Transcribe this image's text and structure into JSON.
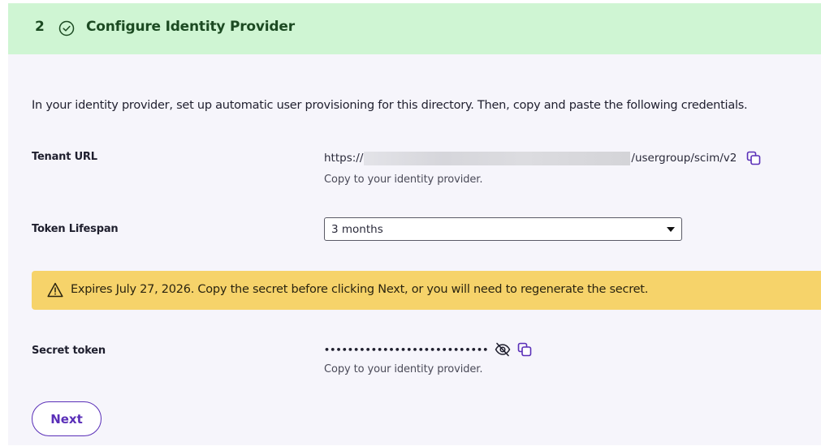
{
  "header": {
    "step_number": "2",
    "title": "Configure Identity Provider",
    "bg_color": "#cff5d3",
    "text_color": "#1c4a22"
  },
  "intro_text": "In your identity provider, set up automatic user provisioning for this directory. Then, copy and paste the following credentials.",
  "tenant_url": {
    "label": "Tenant URL",
    "prefix": "https://",
    "suffix": "/usergroup/scim/v2",
    "hint": "Copy to your identity provider."
  },
  "token_lifespan": {
    "label": "Token Lifespan",
    "selected": "3 months"
  },
  "warning": {
    "text": "Expires July 27, 2026. Copy the secret before clicking Next, or you will need to regenerate the secret.",
    "bg_color": "#f6d36a"
  },
  "secret_token": {
    "label": "Secret token",
    "masked_value": "••••••••••••••••••••••••••••",
    "hint": "Copy to your identity provider."
  },
  "actions": {
    "next_label": "Next",
    "accent_color": "#5a2fb8"
  },
  "icons": {
    "step_status": "check-circle-icon",
    "copy": "copy-icon",
    "reveal": "eye-off-icon",
    "warning": "warning-triangle-icon",
    "dropdown": "caret-down-icon"
  }
}
